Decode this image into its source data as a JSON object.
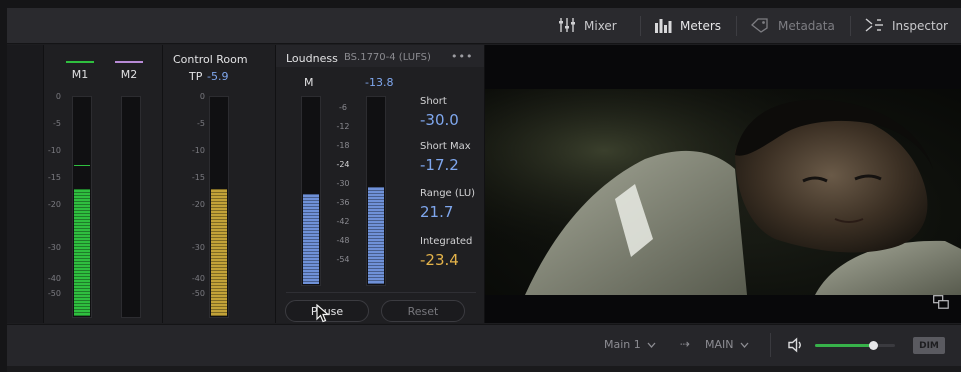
{
  "toolbar": {
    "mixer_label": "Mixer",
    "meters_label": "Meters",
    "metadata_label": "Metadata",
    "inspector_label": "Inspector"
  },
  "meters": {
    "channels": [
      {
        "label": "M1",
        "color": "#2fbf3f"
      },
      {
        "label": "M2",
        "color": "#b78ad6"
      }
    ],
    "scale": [
      "0",
      "-5",
      "-10",
      "-15",
      "-20",
      "-30",
      "-40",
      "-50"
    ]
  },
  "control_room": {
    "title": "Control Room",
    "tp_label": "TP",
    "tp_value": "-5.9",
    "scale": [
      "0",
      "-5",
      "-10",
      "-15",
      "-20",
      "-30",
      "-40",
      "-50"
    ]
  },
  "loudness": {
    "title": "Loudness",
    "standard": "BS.1770-4 (LUFS)",
    "more_label": "•••",
    "m_label": "M",
    "m_value": "-13.8",
    "scale": [
      "-6",
      "-12",
      "-18",
      "-24",
      "-30",
      "-36",
      "-42",
      "-48",
      "-54"
    ],
    "stats": [
      {
        "label": "Short",
        "value": "-30.0"
      },
      {
        "label": "Short Max",
        "value": "-17.2"
      },
      {
        "label": "Range (LU)",
        "value": "21.7"
      },
      {
        "label": "Integrated",
        "value": "-23.4"
      }
    ],
    "pause_label": "Pause",
    "reset_label": "Reset"
  },
  "footer": {
    "source": "Main 1",
    "arrow": "⇢",
    "destination": "MAIN",
    "dim_label": "DIM",
    "volume_level": 0.72
  },
  "colors": {
    "accent_blue": "#7fa7ee",
    "integrated_warn": "#e4b34a",
    "meter_green": "#2fbf3f",
    "meter_yellow": "#c2a238",
    "meter_blue": "#6f91d8"
  }
}
